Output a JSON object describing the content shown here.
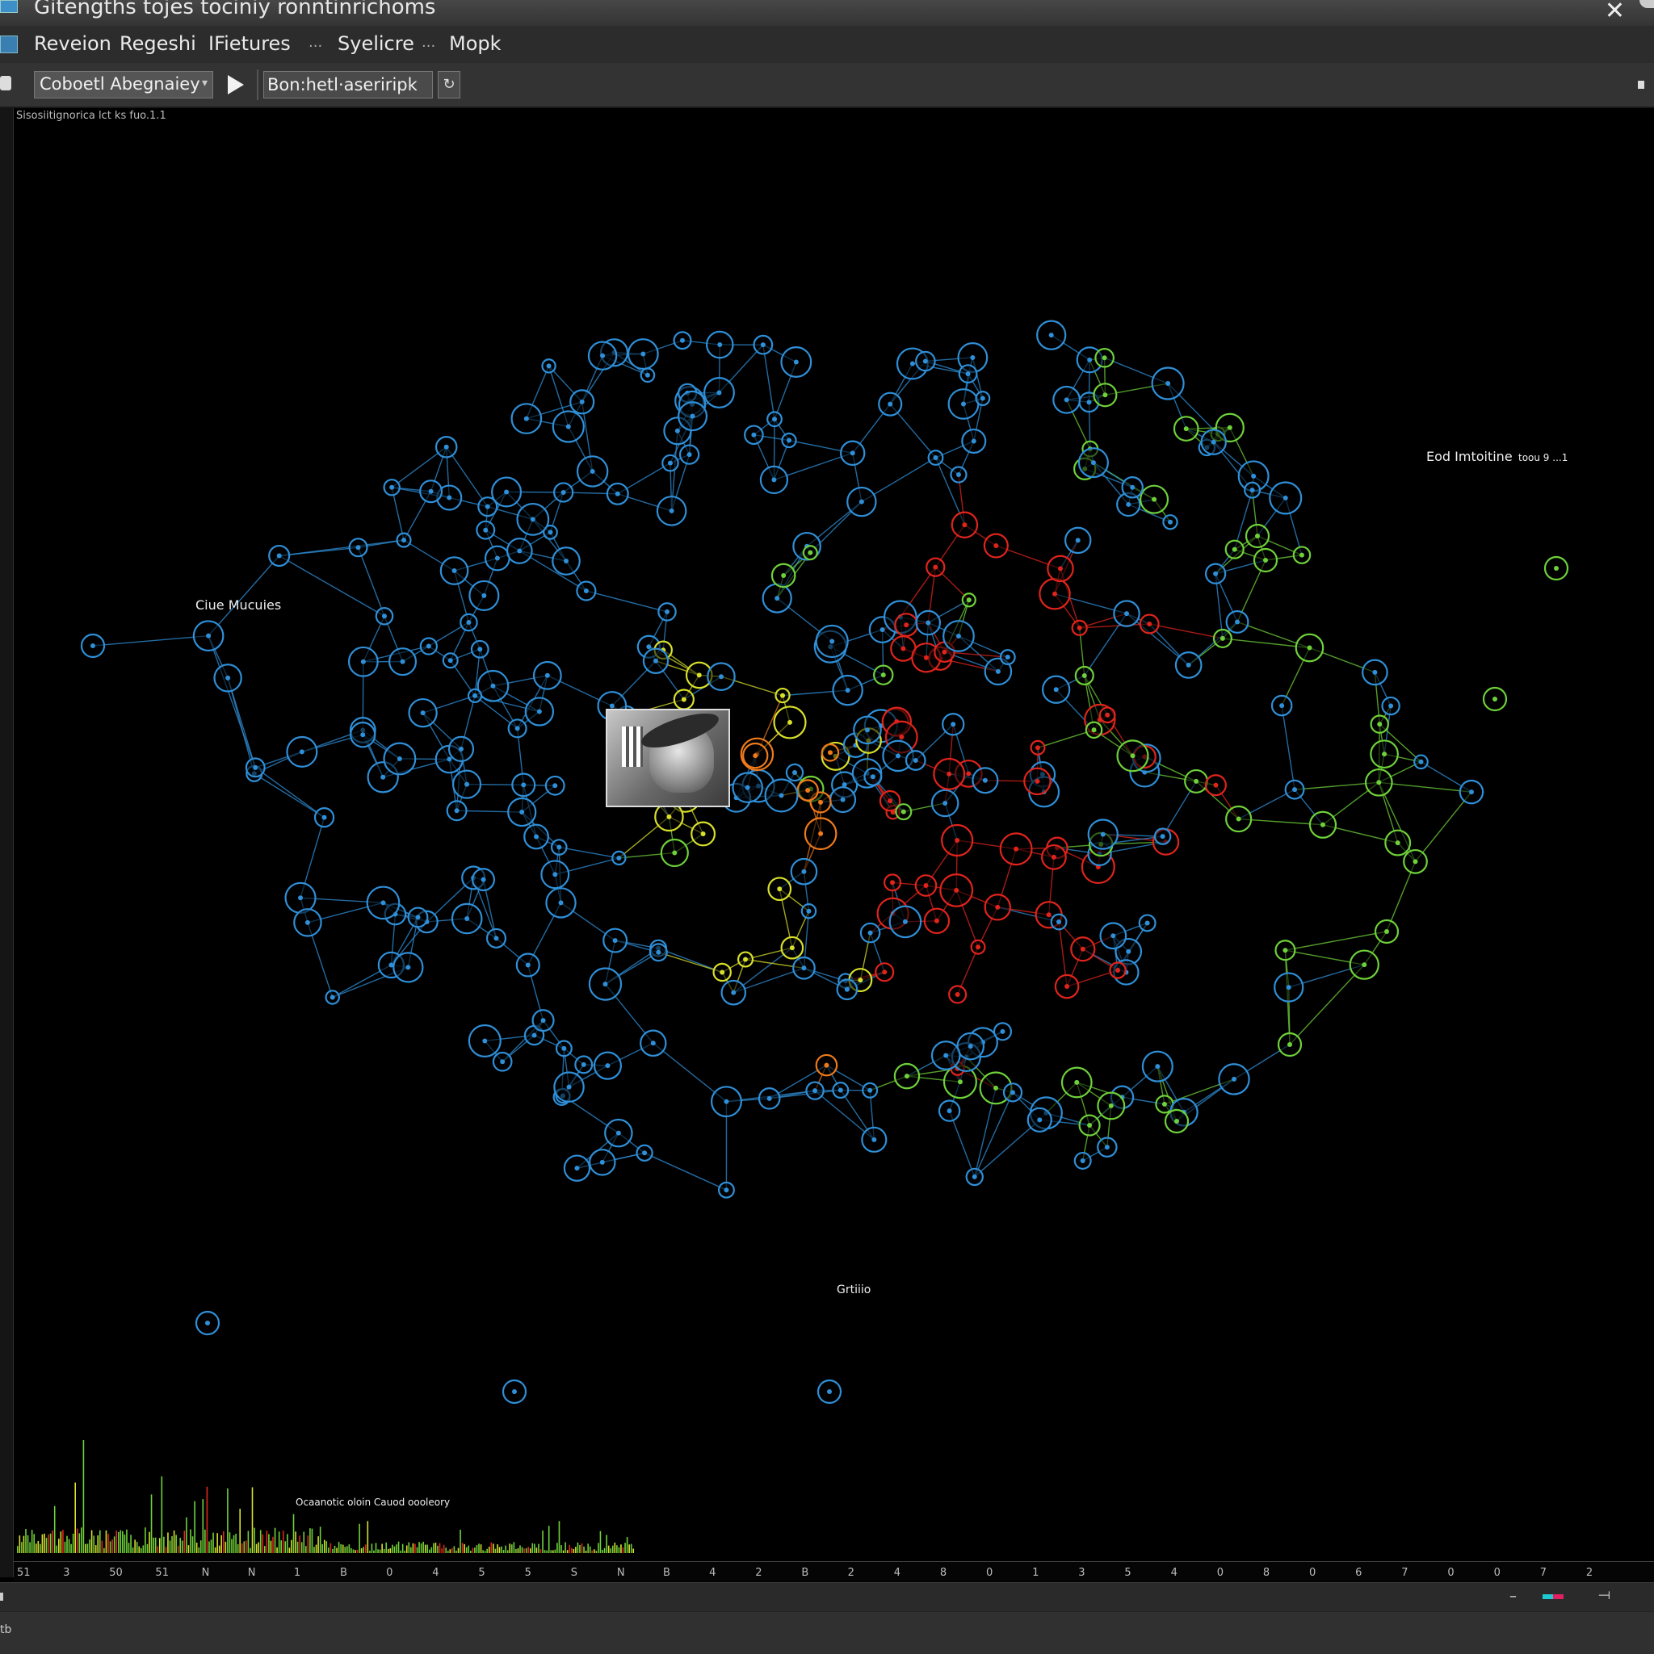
{
  "window": {
    "title": "Gitengths  tojes tociniy ronntinrichoms",
    "close_glyph": "✕"
  },
  "menu": {
    "items": [
      "Reveion",
      "Regeshi",
      "IFietures",
      "Syelicre",
      "Mopk"
    ],
    "separator": "..."
  },
  "toolbar": {
    "select_value": "Coboetl Abegnaiey",
    "search_value": "Bon:hetl·aseriripk",
    "refresh_glyph": "↻"
  },
  "canvas": {
    "status_line": "Sisosiitignorica lct ks fuo.1.1",
    "labels": {
      "left": "Ciue Mucuies",
      "right": "Eod Imtoitine",
      "right_small": "toou 9 ...1",
      "bottom": "Grtiiio",
      "histogram": "Ocaanotic oloin Cauod oooleory"
    },
    "colors": {
      "background": "#000000",
      "blue": "#2f8fd8",
      "yellow": "#d8e02a",
      "green": "#6fd13a",
      "red": "#e0241c",
      "orange": "#ef7a1a"
    }
  },
  "timeline": {
    "ticks": [
      "51",
      "3",
      "50",
      "51",
      "N",
      "N",
      "1",
      "B",
      "0",
      "4",
      "5",
      "5",
      "S",
      "N",
      "B",
      "4",
      "2",
      "B",
      "2",
      "4",
      "8",
      "0",
      "1",
      "3",
      "5",
      "4",
      "0",
      "8",
      "0",
      "6",
      "7",
      "0",
      "0",
      "7",
      "2"
    ]
  },
  "statusbar": {
    "left_text": "tb",
    "zoom_out": "–",
    "fit_glyph": "⟞"
  }
}
